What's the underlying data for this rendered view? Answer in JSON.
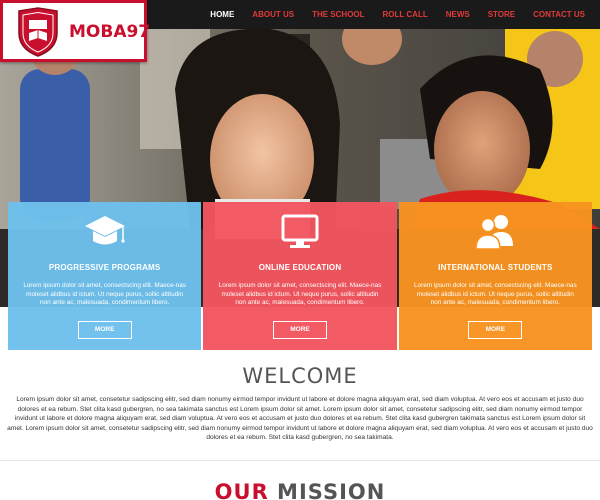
{
  "brand": {
    "name": "MOBA97"
  },
  "nav": [
    {
      "label": "HOME",
      "active": true
    },
    {
      "label": "ABOUT US",
      "active": false
    },
    {
      "label": "THE SCHOOL",
      "active": false
    },
    {
      "label": "ROLL CALL",
      "active": false
    },
    {
      "label": "NEWS",
      "active": false
    },
    {
      "label": "STORE",
      "active": false
    },
    {
      "label": "CONTACT US",
      "active": false
    }
  ],
  "features": [
    {
      "title": "PROGRESSIVE PROGRAMS",
      "text": "Lorem ipsum dolor sit amet, consectscing elit. Maece-nas moleset alidbus id ictum. Ut neque purus, sollic altitudin non ante ac, malesuada, condimentum libero.",
      "button": "MORE",
      "icon": "graduation-cap-icon",
      "color": "#6dc0ec"
    },
    {
      "title": "ONLINE EDUCATION",
      "text": "Lorem ipsum dolor sit amet, consectscing elit. Maece-nas moleset alidbus id ictum. Ut neque purus, sollic altitudin non ante ac, malesuada, condimentum libero.",
      "button": "MORE",
      "icon": "monitor-icon",
      "color": "#f3565f"
    },
    {
      "title": "INTERNATIONAL STUDENTS",
      "text": "Lorem ipsum dolor sit amet, consectscing elit. Maece-nas moleset alidbus id ictum. Ut neque purus, sollic altitudin non ante ac, malesuada, condimentum libero.",
      "button": "MORE",
      "icon": "users-icon",
      "color": "#f89420"
    }
  ],
  "welcome": {
    "title": "WELCOME",
    "text": "Lorem ipsum dolor sit amet, consetetur sadipscing elitr, sed diam nonumy eirmod tempor invidunt ut labore et dolore magna aliquyam erat, sed diam voluptua. At vero eos et accusam et justo duo dolores et ea rebum. Stet clita kasd gubergren, no sea takimata sanctus est Lorem ipsum dolor sit amet. Lorem ipsum dolor sit amet, consetetur sadipscing elitr, sed diam nonumy eirmod tempor invidunt ut labore et dolore magna aliquyam erat, sed diam voluptua. At vero eos et accusam et justo duo dolores et ea rebum. Stet clita kasd gubergren takimata sanctus est Lorem ipsum dolor sit amet. Lorem ipsum dolor sit amet, consetetur sadipscing elitr, sed diam nonumy eirmod tempor invidunt ut labore et dolore magna aliquyam erat, sed diam voluptua. At vero eos et accusam et justo duo dolores et ea rebum. Stet clita kasd gubergren, no sea takimata."
  },
  "mission": {
    "accent": "OUR",
    "rest": " MISSION"
  },
  "colors": {
    "accent": "#c8102e",
    "header": "#1a1a1a"
  }
}
